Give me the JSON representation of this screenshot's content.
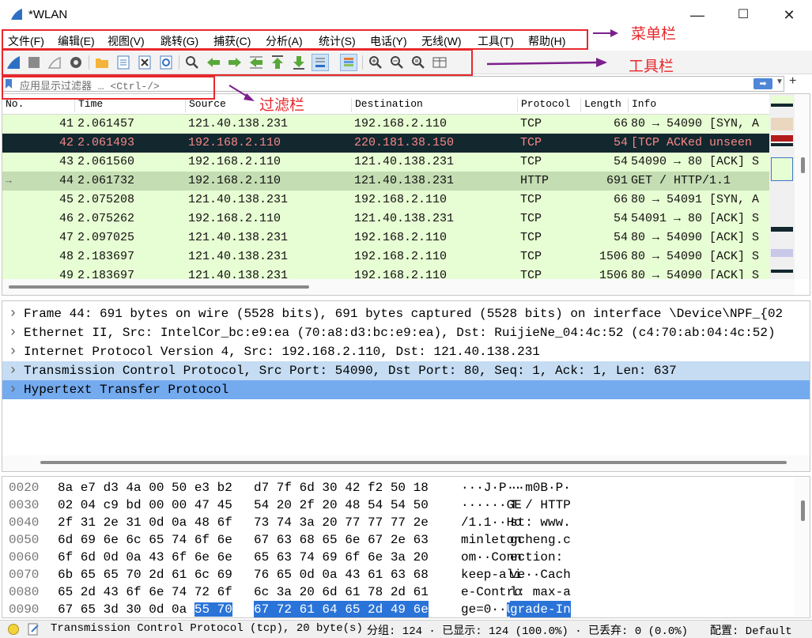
{
  "window": {
    "title": "*WLAN",
    "controls": [
      "—",
      "☐",
      "✕"
    ]
  },
  "menubar": {
    "items": [
      "文件(F)",
      "编辑(E)",
      "视图(V)",
      "跳转(G)",
      "捕获(C)",
      "分析(A)",
      "统计(S)",
      "电话(Y)",
      "无线(W)",
      "工具(T)",
      "帮助(H)"
    ]
  },
  "toolbar": {
    "icons": [
      "start-capture-icon",
      "stop-capture-icon",
      "restart-capture-icon",
      "capture-options-icon",
      "open-file-icon",
      "save-file-icon",
      "close-file-icon",
      "reload-file-icon",
      "find-packet-icon",
      "go-back-icon",
      "go-forward-icon",
      "go-to-packet-icon",
      "go-first-icon",
      "go-last-icon",
      "autoscroll-icon",
      "colorize-icon",
      "zoom-in-icon",
      "zoom-out-icon",
      "zoom-reset-icon",
      "resize-columns-icon"
    ]
  },
  "filter": {
    "placeholder": "应用显示过滤器 … <Ctrl-/>"
  },
  "packet_list": {
    "columns": [
      "No.",
      "Time",
      "Source",
      "Destination",
      "Protocol",
      "Length",
      "Info"
    ],
    "rows": [
      {
        "no": "41",
        "time": "2.061457",
        "src": "121.40.138.231",
        "dst": "192.168.2.110",
        "proto": "TCP",
        "len": "66",
        "info": "80 → 54090 [SYN, A",
        "style": "tcp"
      },
      {
        "no": "42",
        "time": "2.061493",
        "src": "192.168.2.110",
        "dst": "220.181.38.150",
        "proto": "TCP",
        "len": "54",
        "info": "[TCP ACKed unseen",
        "style": "bad"
      },
      {
        "no": "43",
        "time": "2.061560",
        "src": "192.168.2.110",
        "dst": "121.40.138.231",
        "proto": "TCP",
        "len": "54",
        "info": "54090 → 80 [ACK] S",
        "style": "tcp"
      },
      {
        "no": "44",
        "time": "2.061732",
        "src": "192.168.2.110",
        "dst": "121.40.138.231",
        "proto": "HTTP",
        "len": "691",
        "info": "GET / HTTP/1.1",
        "style": "selected"
      },
      {
        "no": "45",
        "time": "2.075208",
        "src": "121.40.138.231",
        "dst": "192.168.2.110",
        "proto": "TCP",
        "len": "66",
        "info": "80 → 54091 [SYN, A",
        "style": "tcp"
      },
      {
        "no": "46",
        "time": "2.075262",
        "src": "192.168.2.110",
        "dst": "121.40.138.231",
        "proto": "TCP",
        "len": "54",
        "info": "54091 → 80 [ACK] S",
        "style": "tcp"
      },
      {
        "no": "47",
        "time": "2.097025",
        "src": "121.40.138.231",
        "dst": "192.168.2.110",
        "proto": "TCP",
        "len": "54",
        "info": "80 → 54090 [ACK] S",
        "style": "tcp"
      },
      {
        "no": "48",
        "time": "2.183697",
        "src": "121.40.138.231",
        "dst": "192.168.2.110",
        "proto": "TCP",
        "len": "1506",
        "info": "80 → 54090 [ACK] S",
        "style": "tcp"
      },
      {
        "no": "49",
        "time": "2.183697",
        "src": "121.40.138.231",
        "dst": "192.168.2.110",
        "proto": "TCP",
        "len": "1506",
        "info": "80 → 54090 [ACK] S",
        "style": "tcp"
      }
    ]
  },
  "details": {
    "rows": [
      {
        "text": "Frame 44: 691 bytes on wire (5528 bits), 691 bytes captured (5528 bits) on interface \\Device\\NPF_{02",
        "style": "normal"
      },
      {
        "text": "Ethernet II, Src: IntelCor_bc:e9:ea (70:a8:d3:bc:e9:ea), Dst: RuijieNe_04:4c:52 (c4:70:ab:04:4c:52)",
        "style": "normal"
      },
      {
        "text": "Internet Protocol Version 4, Src: 192.168.2.110, Dst: 121.40.138.231",
        "style": "normal"
      },
      {
        "text": "Transmission Control Protocol, Src Port: 54090, Dst Port: 80, Seq: 1, Ack: 1, Len: 637",
        "style": "light"
      },
      {
        "text": "Hypertext Transfer Protocol",
        "style": "selected"
      }
    ]
  },
  "bytes": {
    "rows": [
      {
        "off": "0020",
        "hex1": "8a e7 d3 4a 00 50 e3 b2",
        "hex2": "d7 7f 6d 30 42 f2 50 18",
        "asc1": "···J·P··",
        "asc2": "··m0B·P·"
      },
      {
        "off": "0030",
        "hex1": "02 04 c9 bd 00 00 47 45",
        "hex2": "54 20 2f 20 48 54 54 50",
        "asc1": "······GE",
        "asc2": "T / HTTP"
      },
      {
        "off": "0040",
        "hex1": "2f 31 2e 31 0d 0a 48 6f",
        "hex2": "73 74 3a 20 77 77 77 2e",
        "asc1": "/1.1··Ho",
        "asc2": "st: www."
      },
      {
        "off": "0050",
        "hex1": "6d 69 6e 6c 65 74 6f 6e",
        "hex2": "67 63 68 65 6e 67 2e 63",
        "asc1": "minleton",
        "asc2": "gcheng.c"
      },
      {
        "off": "0060",
        "hex1": "6f 6d 0d 0a 43 6f 6e 6e",
        "hex2": "65 63 74 69 6f 6e 3a 20",
        "asc1": "om··Conn",
        "asc2": "ection: "
      },
      {
        "off": "0070",
        "hex1": "6b 65 65 70 2d 61 6c 69",
        "hex2": "76 65 0d 0a 43 61 63 68",
        "asc1": "keep-ali",
        "asc2": "ve··Cach"
      },
      {
        "off": "0080",
        "hex1": "65 2d 43 6f 6e 74 72 6f",
        "hex2": "6c 3a 20 6d 61 78 2d 61",
        "asc1": "e-Contro",
        "asc2": "l: max-a"
      },
      {
        "off": "0090",
        "hex1": "67 65 3d 30 0d 0a",
        "hex1_hl": "55 70",
        "hex2": "67 72 61 64 65 2d 49 6e",
        "asc1": "ge=0··",
        "asc1_hl": "Up",
        "asc2": "grade-In"
      }
    ]
  },
  "statusbar": {
    "field": "Transmission Control Protocol (tcp), 20 byte(s)",
    "packets": "分组: 124 · 已显示: 124 (100.0%) · 已丢弃: 0 (0.0%)",
    "profile": "配置: Default"
  },
  "annotations": {
    "menubar": "菜单栏",
    "toolbar": "工具栏",
    "filter": "过滤栏"
  },
  "colors": {
    "tcp_row": "#e7fdd3",
    "bad_row_bg": "#12272e",
    "bad_row_fg": "#f78788",
    "selected_row": "#c4ddb3",
    "details_light": "#c5dcf2",
    "details_selected": "#74aaee",
    "hex_highlight": "#2a73d8",
    "annotation": "#e8282c",
    "arrow": "#7c1f8c"
  }
}
